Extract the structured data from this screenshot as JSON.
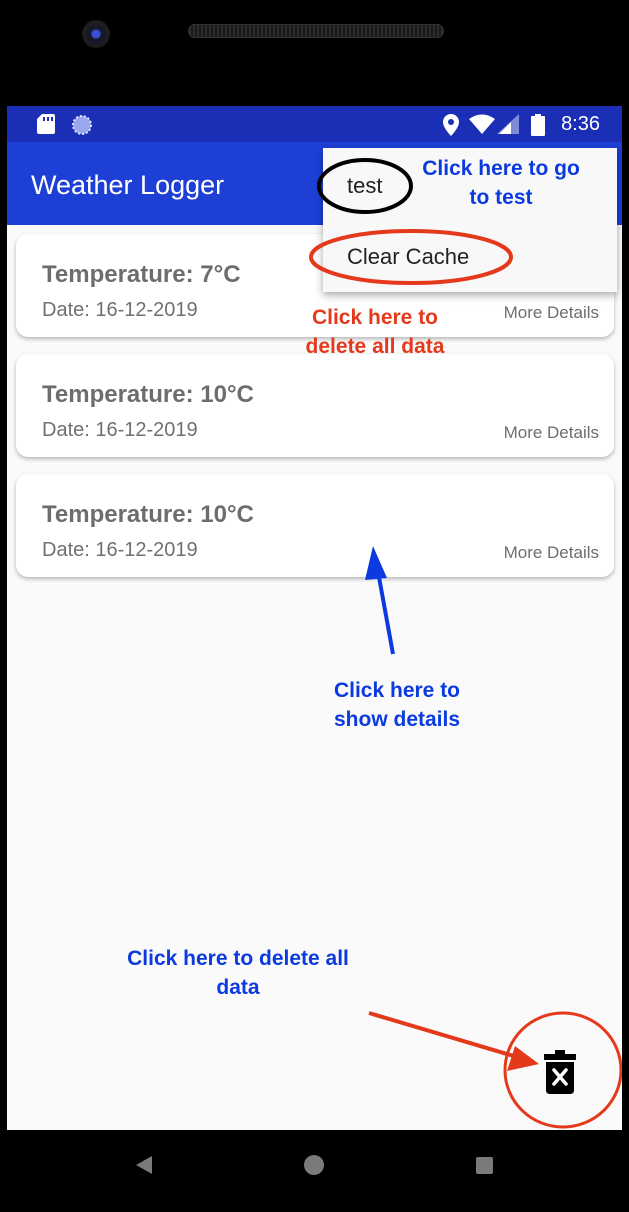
{
  "status_bar": {
    "time": "8:36",
    "icons": [
      "sd-card-icon",
      "sync-icon",
      "location-icon",
      "wifi-icon",
      "signal-icon",
      "battery-icon"
    ]
  },
  "app_bar": {
    "title": "Weather Logger"
  },
  "menu": {
    "items": [
      {
        "label": "test"
      },
      {
        "label": "Clear Cache"
      }
    ]
  },
  "records": [
    {
      "temperature": "Temperature: 7°C",
      "date": "Date: 16-12-2019",
      "more": "More Details"
    },
    {
      "temperature": "Temperature: 10°C",
      "date": "Date: 16-12-2019",
      "more": "More Details"
    },
    {
      "temperature": "Temperature: 10°C",
      "date": "Date: 16-12-2019",
      "more": "More Details"
    }
  ],
  "annotations": {
    "go_to_test": "Click here to go to test",
    "delete_all_menu": "Click here to delete all data",
    "show_details": "Click here to show details",
    "delete_all_fab": "Click here to delete all data"
  },
  "colors": {
    "status_bar": "#1a2fb5",
    "app_bar": "#1e3fd6",
    "annotation_blue": "#0b3be0",
    "annotation_red": "#e4391b"
  },
  "fab": {
    "icon": "delete-forever-icon"
  },
  "nav_bar": {
    "icons": [
      "back-icon",
      "home-icon",
      "recents-icon"
    ]
  }
}
